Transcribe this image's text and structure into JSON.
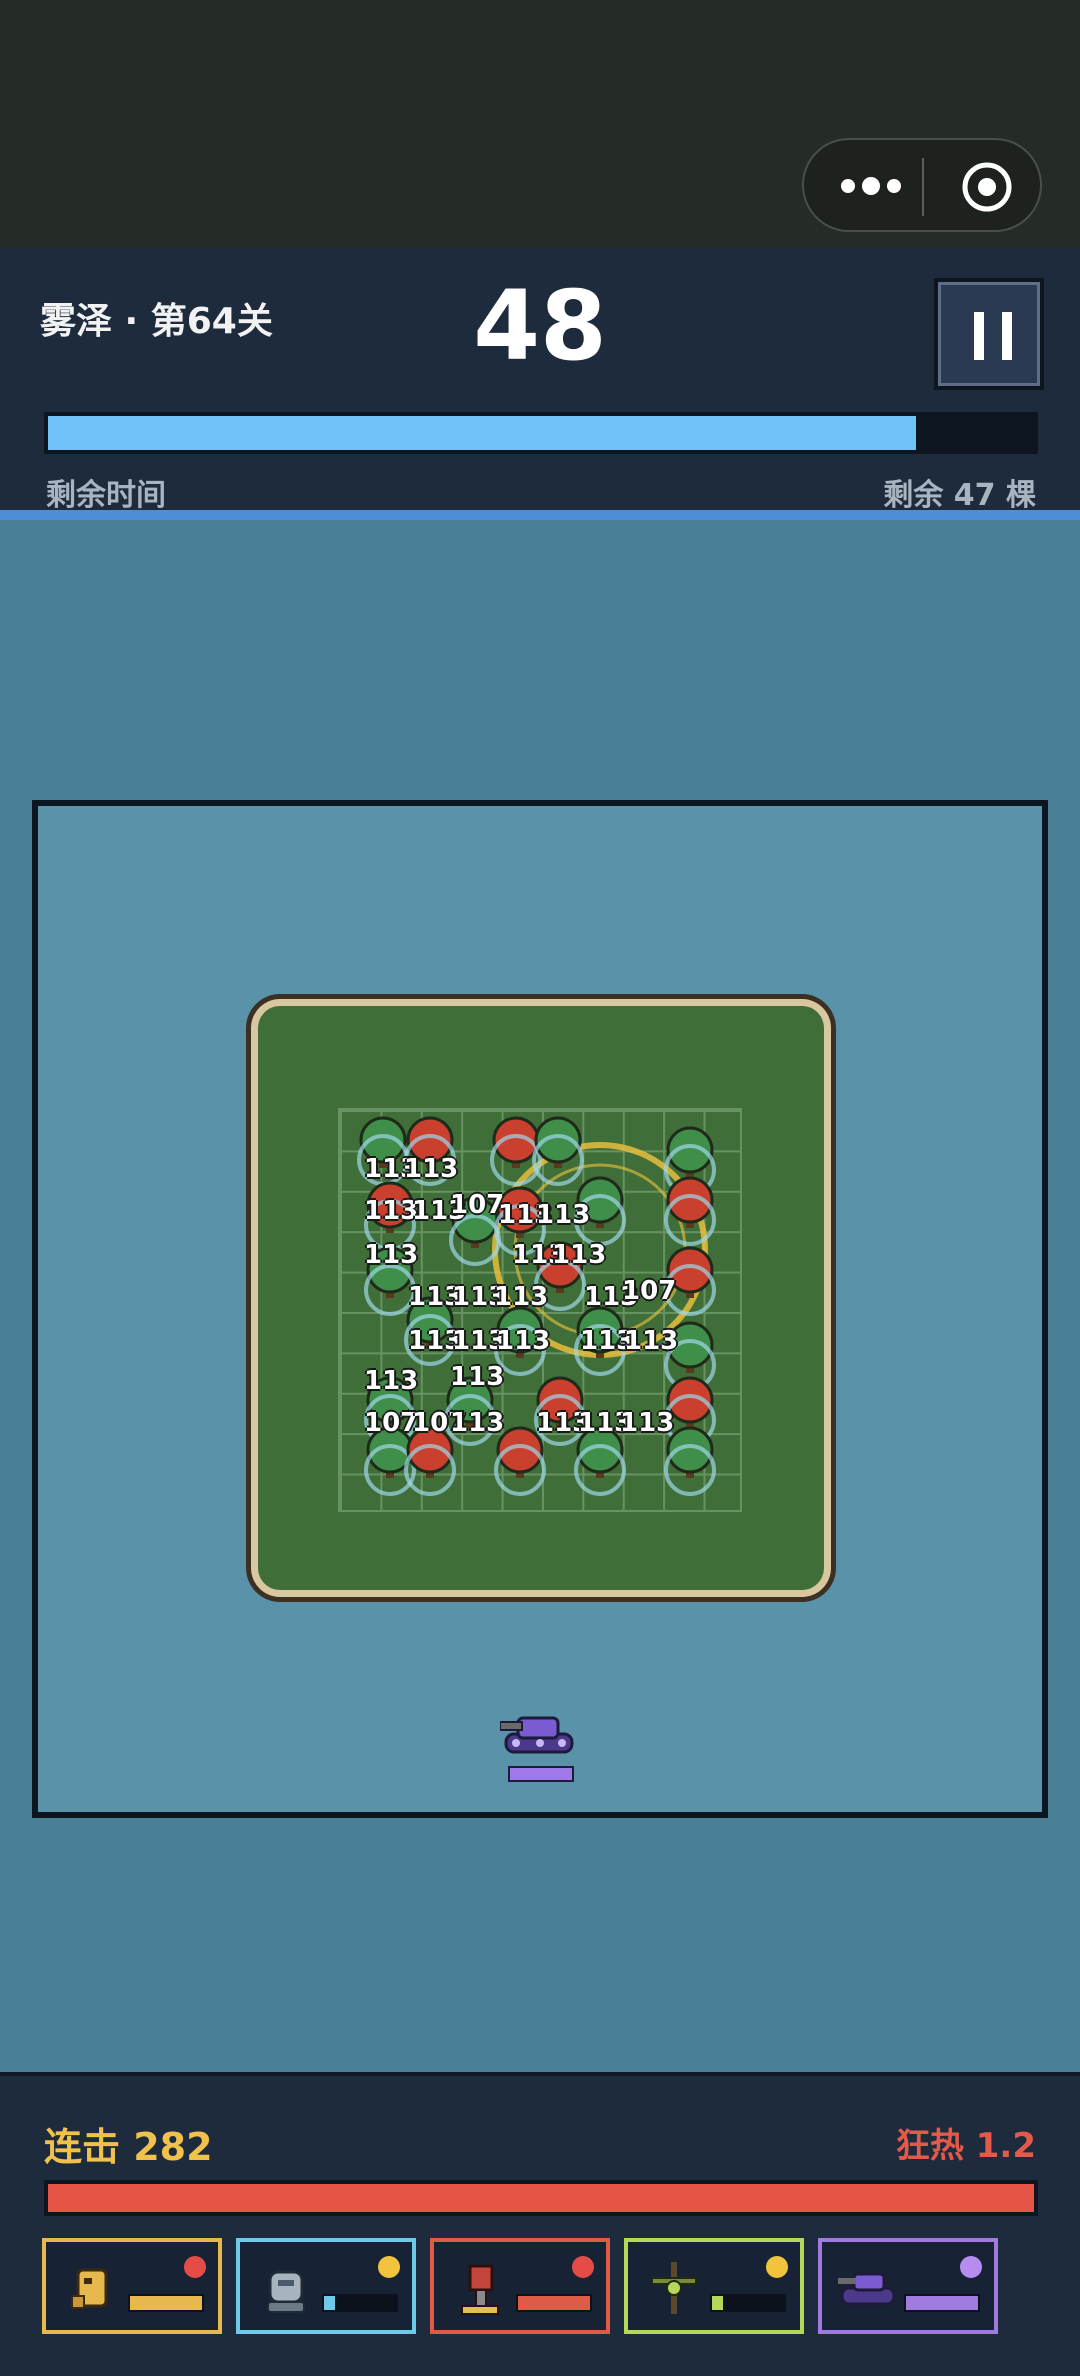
{
  "hud": {
    "level": "雾泽 · 第64关",
    "score": "48",
    "time_label": "剩余时间",
    "remaining_label": "剩余 47 棵",
    "time_progress": 0.88
  },
  "colors": {
    "time_bar": "#6ec2f7",
    "combo_bar": "#e55447",
    "combo_text": "#f0c24b",
    "frenzy_text": "#e35a4a"
  },
  "damage_numbers": [
    "113",
    "113",
    "113",
    "113",
    "107",
    "113",
    "113",
    "113",
    "113",
    "113",
    "113",
    "113",
    "113",
    "113",
    "107",
    "113",
    "113",
    "113",
    "113",
    "113",
    "113",
    "113",
    "107",
    "107",
    "113",
    "113",
    "113",
    "113"
  ],
  "footer": {
    "combo": "连击 282",
    "frenzy": "狂热 1.2",
    "combo_progress": 1.0
  },
  "units": [
    {
      "name": "golden-golem",
      "border": "#e7b84e",
      "dot": "#e54c45",
      "bar": "#e7b84e",
      "level": 1.0
    },
    {
      "name": "steel-robot",
      "border": "#6fc9e8",
      "dot": "#f2c33c",
      "bar": "#6fc9e8",
      "level": 0.15
    },
    {
      "name": "red-drill",
      "border": "#e05a48",
      "dot": "#e54c45",
      "bar": "#e05a48",
      "level": 1.0
    },
    {
      "name": "green-crossbow",
      "border": "#b5d85a",
      "dot": "#f2c33c",
      "bar": "#b5d85a",
      "level": 0.15
    },
    {
      "name": "purple-tank",
      "border": "#a17ae0",
      "dot": "#b68cf0",
      "bar": "#a17ae0",
      "level": 1.0
    }
  ]
}
